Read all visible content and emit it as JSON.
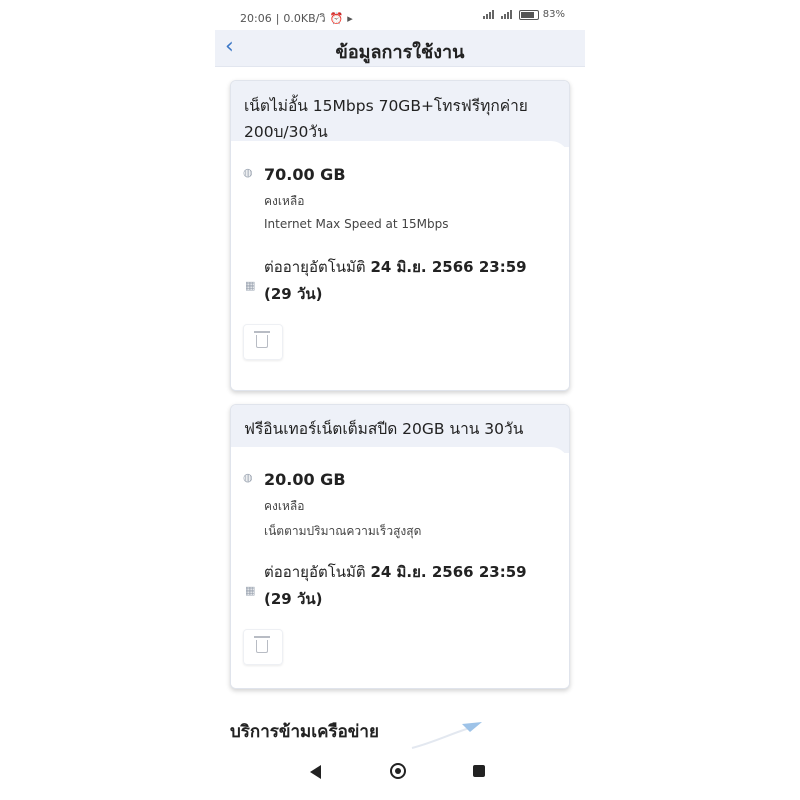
{
  "status_bar": {
    "time": "20:06",
    "speed": "0.0KB/วิ",
    "battery": "83"
  },
  "header": {
    "back_glyph": "‹",
    "title": "ข้อมูลการใช้งาน"
  },
  "packages": [
    {
      "name": "เน็ตไม่อั้น 15Mbps 70GB+โทรฟรีทุกค่าย 200บ/30วัน",
      "amount": "70.00 GB",
      "remaining_label": "คงเหลือ",
      "description": "Internet Max Speed at 15Mbps",
      "renew_label": "ต่ออายุอัตโนมัติ",
      "renew_date": "24 มิ.ย. 2566 23:59 (29 วัน)"
    },
    {
      "name": "ฟรีอินเทอร์เน็ตเต็มสปีด 20GB นาน 30วัน",
      "amount": "20.00 GB",
      "remaining_label": "คงเหลือ",
      "description": "เน็ตตามปริมาณความเร็วสูงสุด",
      "renew_label": "ต่ออายุอัตโนมัติ",
      "renew_date": "24 มิ.ย. 2566 23:59 (29 วัน)"
    }
  ],
  "roaming": {
    "title": "บริการข้ามเครือข่าย"
  },
  "icons": [
    "globe-icon",
    "calendar-icon",
    "trash-icon",
    "back-arrow-icon",
    "alarm-icon",
    "signal-icon",
    "battery-icon"
  ],
  "colors": {
    "accent": "#3b77c7",
    "header_bg": "#eef1f8"
  }
}
